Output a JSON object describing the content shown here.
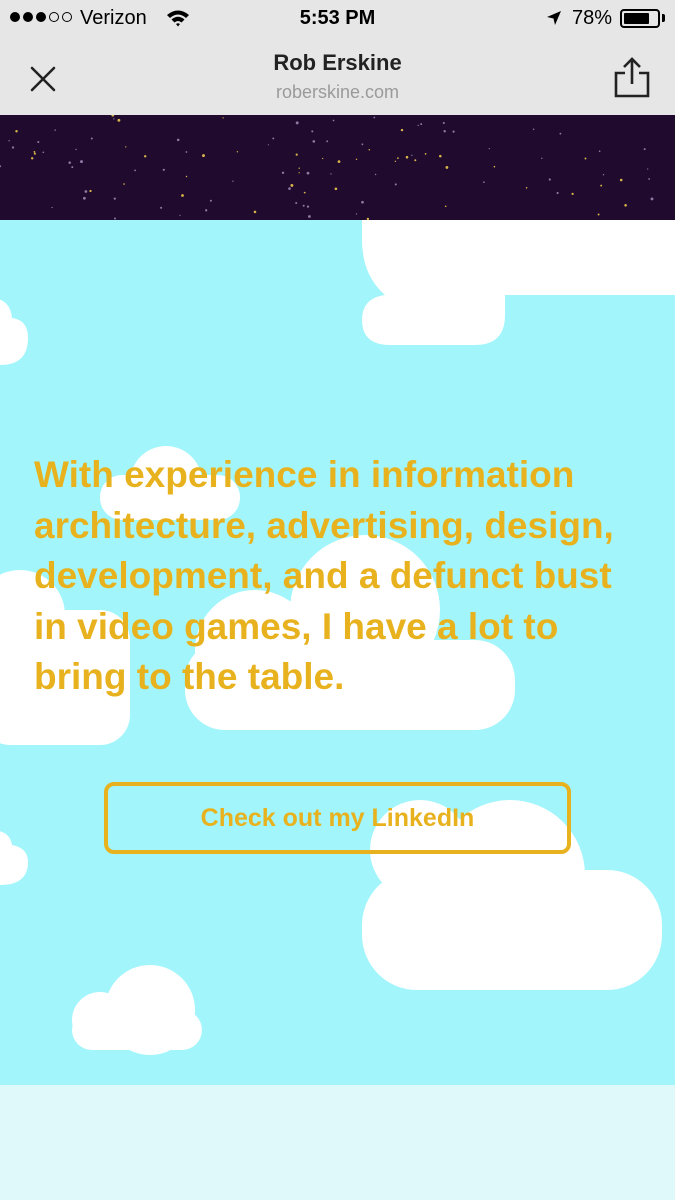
{
  "status_bar": {
    "carrier": "Verizon",
    "time": "5:53 PM",
    "battery_percent": "78%",
    "battery_level": 0.78,
    "signal_bars_filled": 3,
    "signal_bars_total": 5
  },
  "browser": {
    "title": "Rob Erskine",
    "url": "roberskine.com",
    "close_icon": "close-icon",
    "share_icon": "share-icon"
  },
  "page": {
    "headline": "With experience in information architecture, advertising, design, development, and a defunct bust in video games, I have a lot to bring to the table.",
    "cta_label": "Check out my LinkedIn"
  },
  "colors": {
    "space": "#200a2e",
    "sky": "#a1f5fb",
    "accent": "#e8b21e",
    "cloud": "#ffffff"
  }
}
